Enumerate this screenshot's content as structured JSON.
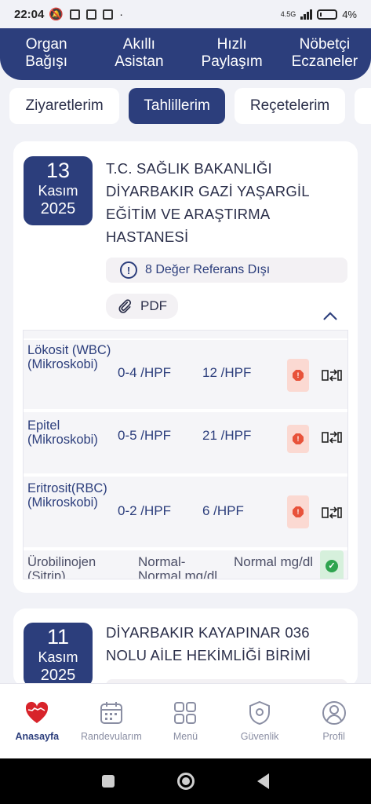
{
  "status_bar": {
    "time": "22:04",
    "network": "4.5G",
    "battery": "4%"
  },
  "top_nav": [
    {
      "line1": "Organ",
      "line2": "Bağışı"
    },
    {
      "line1": "Akıllı",
      "line2": "Asistan"
    },
    {
      "line1": "Hızlı",
      "line2": "Paylaşım"
    },
    {
      "line1": "Nöbetçi",
      "line2": "Eczaneler"
    }
  ],
  "tabs": [
    "Ziyaretlerim",
    "Tahlillerim",
    "Reçetelerim"
  ],
  "active_tab": "Tahlillerim",
  "cards": [
    {
      "day": "13",
      "month": "Kasım",
      "year": "2025",
      "hospital": "T.C. SAĞLIK BAKANLIĞI DİYARBAKIR GAZİ YAŞARGİL EĞİTİM VE ARAŞTIRMA HASTANESİ",
      "warning": "8 Değer Referans Dışı",
      "pdf_label": "PDF",
      "results": [
        {
          "name": "Lökosit (WBC) (Mikroskobi)",
          "ref": "0-4 /HPF",
          "value": "12 /HPF",
          "status": "high"
        },
        {
          "name": "Epitel (Mikroskobi)",
          "ref": "0-5 /HPF",
          "value": "21 /HPF",
          "status": "high"
        },
        {
          "name": "Eritrosit(RBC) (Mikroskobi)",
          "ref": "0-2 /HPF",
          "value": "6 /HPF",
          "status": "high"
        },
        {
          "name": "Ürobilinojen (Sitrip)",
          "ref": "Normal-Normal mg/dl",
          "value": "Normal mg/dl",
          "status": "ok"
        }
      ]
    },
    {
      "day": "11",
      "month": "Kasım",
      "year": "2025",
      "hospital": "DİYARBAKIR KAYAPINAR 036 NOLU AİLE HEKİMLİĞİ BİRİMİ"
    }
  ],
  "bottom_nav": [
    {
      "label": "Anasayfa",
      "icon": "heart-map-icon"
    },
    {
      "label": "Randevularım",
      "icon": "calendar-icon"
    },
    {
      "label": "Menü",
      "icon": "grid-icon"
    },
    {
      "label": "Güvenlik",
      "icon": "shield-gear-icon"
    },
    {
      "label": "Profil",
      "icon": "user-icon"
    }
  ],
  "colors": {
    "primary": "#2c3e7c",
    "alert": "#e8523a",
    "ok": "#2ea44f"
  }
}
